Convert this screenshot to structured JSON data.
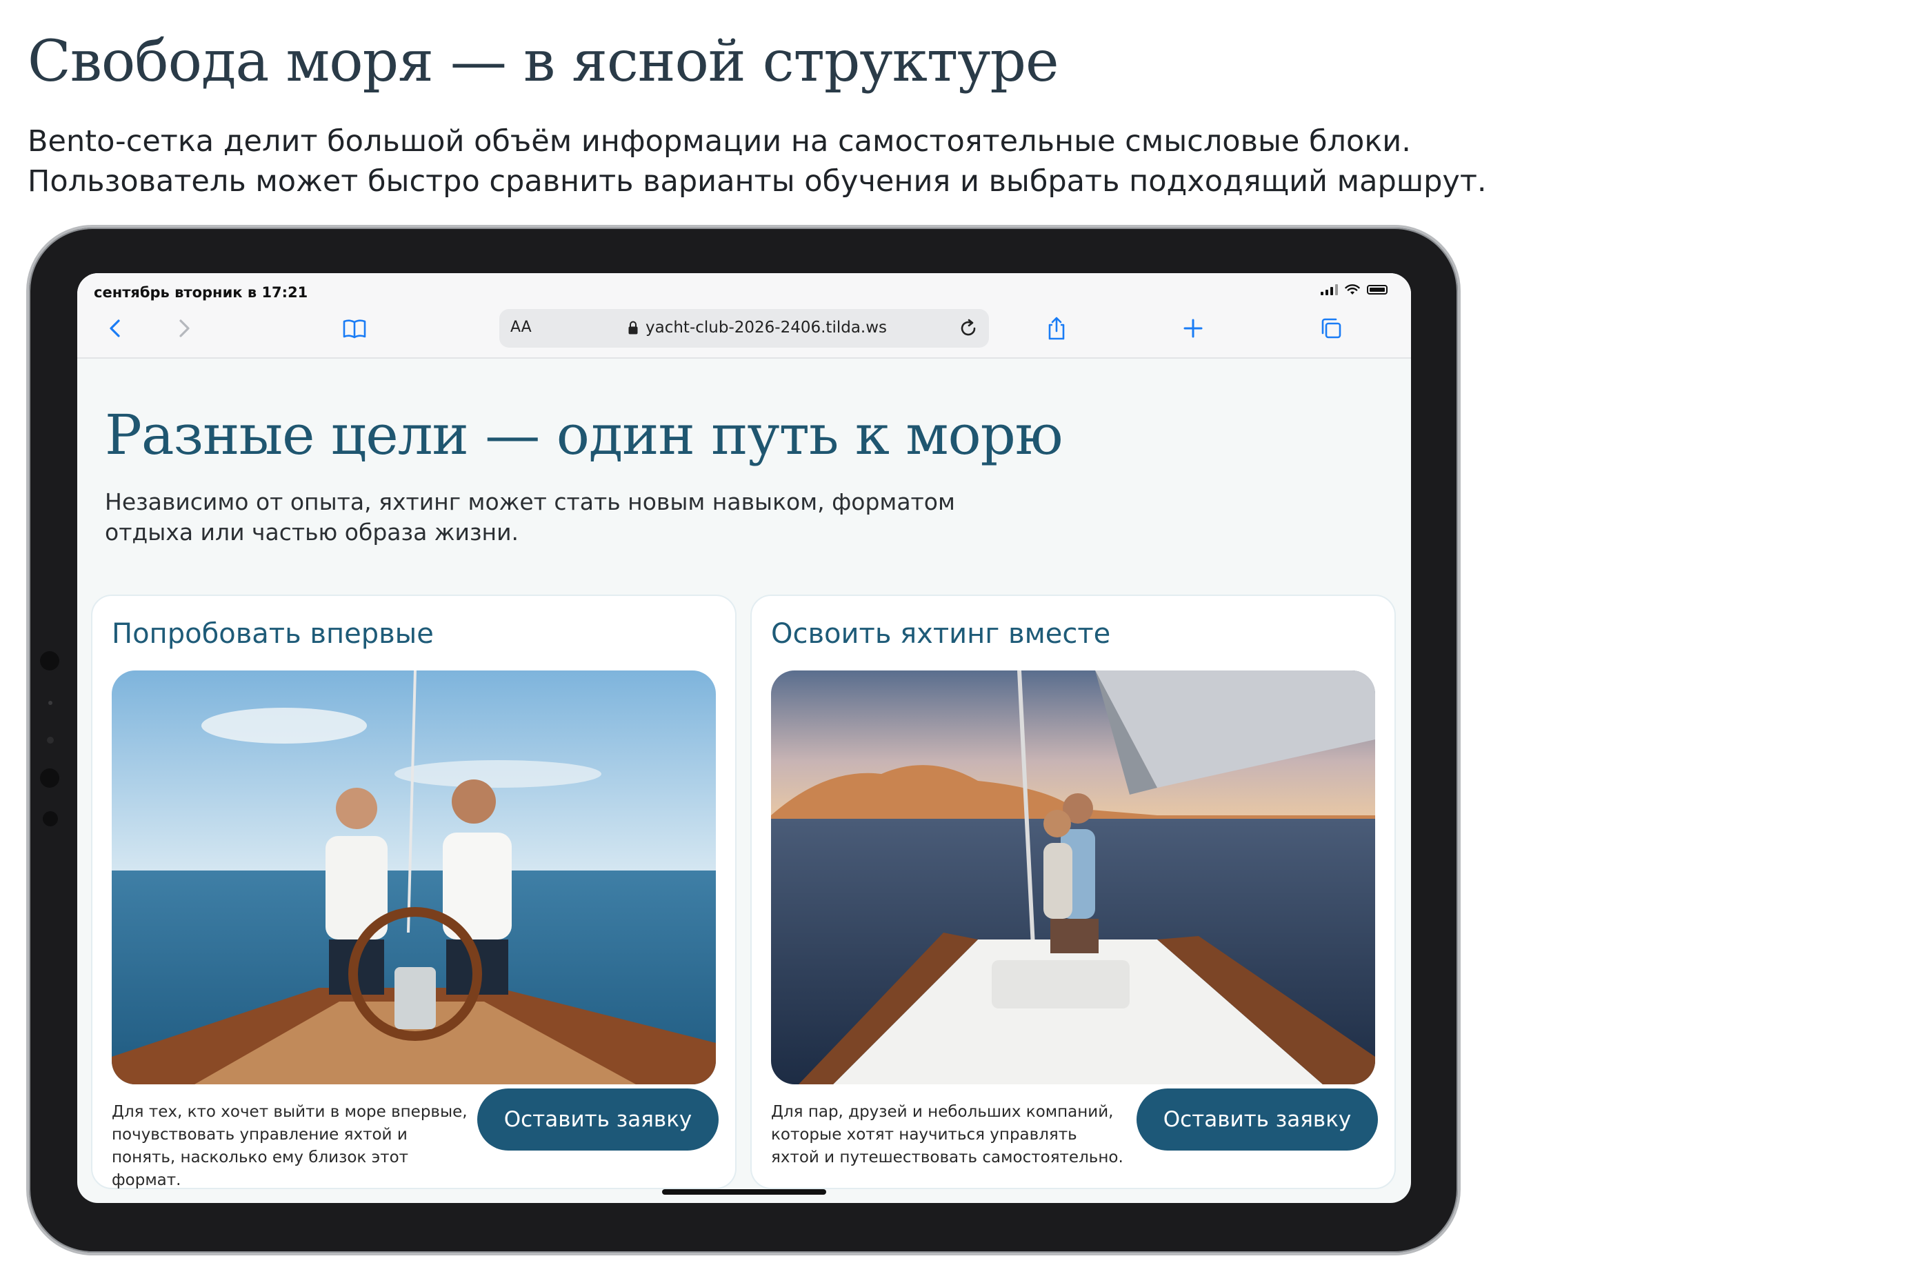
{
  "slide": {
    "title": "Свобода моря — в ясной структуре",
    "subtitle_line1": "Bento-сетка делит большой объём информации на самостоятельные смысловые блоки.",
    "subtitle_line2": "Пользователь может быстро сравнить варианты обучения и выбрать подходящий маршрут."
  },
  "status_bar": {
    "time": "сентябрь вторник в 17:21",
    "icons": [
      "signal-icon",
      "wifi-icon",
      "battery-icon"
    ]
  },
  "browser": {
    "text_size_label": "AA",
    "url": "yacht-club-2026-2406.tilda.ws",
    "toolbar_icons": [
      "back-icon",
      "forward-icon",
      "bookmarks-icon",
      "reload-icon",
      "share-icon",
      "add-tab-icon",
      "tabs-icon"
    ],
    "accent": "#1a7cf5"
  },
  "page": {
    "heading": "Разные цели — один путь к морю",
    "lead": "Независимо от опыта, яхтинг может стать новым навыком, форматом отдыха или частью образа жизни.",
    "cards": [
      {
        "title": "Попробовать впервые",
        "description": "Для тех, кто хочет выйти в море впервые, почувствовать управление яхтой и понять, насколько ему близок  этот формат.",
        "button": "Оставить заявку"
      },
      {
        "title": "Освоить яхтинг вместе",
        "description": "Для пар, друзей и небольших компаний, которые хотят научиться управлять яхтой и путешествовать самостоятельно.",
        "button": "Оставить заявку"
      }
    ]
  },
  "colors": {
    "heading": "#1f5670",
    "button": "#1d5878",
    "page_bg": "#f5f8f8"
  }
}
